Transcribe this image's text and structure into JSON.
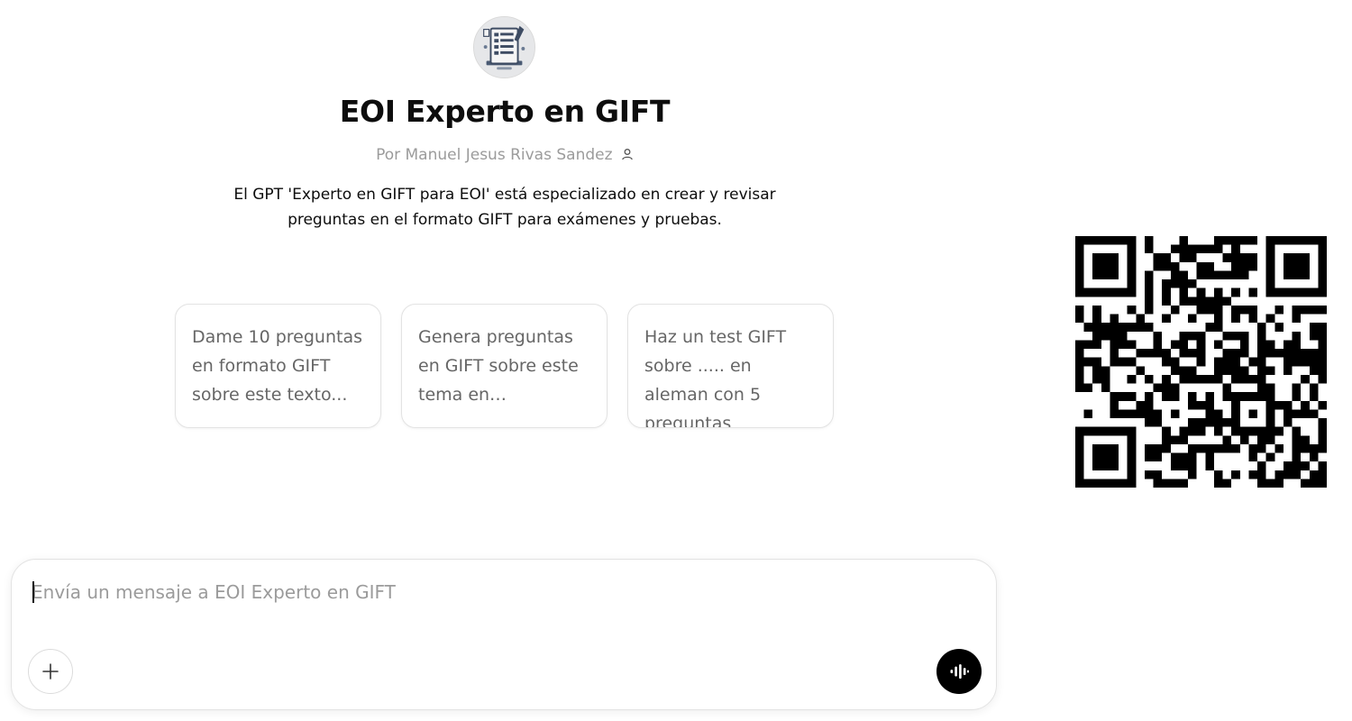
{
  "gpt": {
    "title": "EOI Experto en GIFT",
    "author": "Por Manuel Jesus Rivas Sandez",
    "description": "El GPT 'Experto en GIFT para EOI' está especializado en crear y revisar preguntas en el formato GIFT para exámenes y pruebas.",
    "avatar_icon": "quiz-document-icon"
  },
  "starters": [
    {
      "label": "Dame 10 preguntas en formato GIFT sobre este texto..."
    },
    {
      "label": "Genera preguntas en GIFT sobre este tema en…"
    },
    {
      "label": "Haz un test GIFT sobre ..... en aleman con 5 preguntas"
    }
  ],
  "composer": {
    "placeholder": "Envía un mensaje a EOI Experto en GIFT",
    "value": "",
    "attach_icon": "plus-icon",
    "voice_icon": "voice-waveform-icon"
  },
  "qr_code": {
    "icon": "qr-code"
  },
  "colors": {
    "text_primary": "#0d0d0d",
    "text_muted": "#9b9b9b",
    "card_text": "#666666",
    "border": "#e3e3e3",
    "voice_button": "#000000"
  }
}
